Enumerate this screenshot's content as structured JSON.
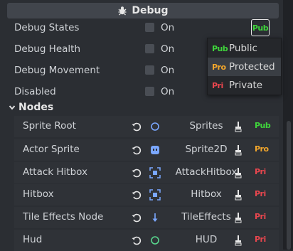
{
  "header": {
    "title": "Debug",
    "icon": "bug-icon"
  },
  "properties": [
    {
      "label": "Debug States",
      "checked": false,
      "value_text": "On"
    },
    {
      "label": "Debug Health",
      "checked": false,
      "value_text": "On"
    },
    {
      "label": "Debug Movement",
      "checked": false,
      "value_text": "On"
    },
    {
      "label": "Disabled",
      "checked": false,
      "value_text": "On"
    }
  ],
  "access_button": {
    "badge": "Pub"
  },
  "access_menu": {
    "items": [
      {
        "badge": "Pub",
        "label": "Public",
        "highlighted": false
      },
      {
        "badge": "Pro",
        "label": "Protected",
        "highlighted": true
      },
      {
        "badge": "Pri",
        "label": "Private",
        "highlighted": false
      }
    ]
  },
  "nodes_section": {
    "title": "Nodes",
    "expanded": true
  },
  "nodes": [
    {
      "label": "Sprite Root",
      "type": "Sprites",
      "type_icon": "circle-icon",
      "access": "Pub"
    },
    {
      "label": "Actor Sprite",
      "type": "Sprite2D",
      "type_icon": "sprite-icon",
      "access": "Pro"
    },
    {
      "label": "Attack Hitbox",
      "type": "AttackHitbox",
      "type_icon": "area-icon",
      "access": "Pri"
    },
    {
      "label": "Hitbox",
      "type": "Hitbox",
      "type_icon": "area-icon",
      "access": "Pri"
    },
    {
      "label": "Tile Effects Node",
      "type": "TileEffects",
      "type_icon": "down-arrow-icon",
      "access": "Pri"
    },
    {
      "label": "Hud",
      "type": "HUD",
      "type_icon": "green-circle-icon",
      "access": "Pri"
    }
  ],
  "colors": {
    "public": "#3fd43b",
    "protected": "#f2a62c",
    "private": "#e8464e",
    "node_blue": "#7aa7ff",
    "hud_green": "#58d68d"
  }
}
